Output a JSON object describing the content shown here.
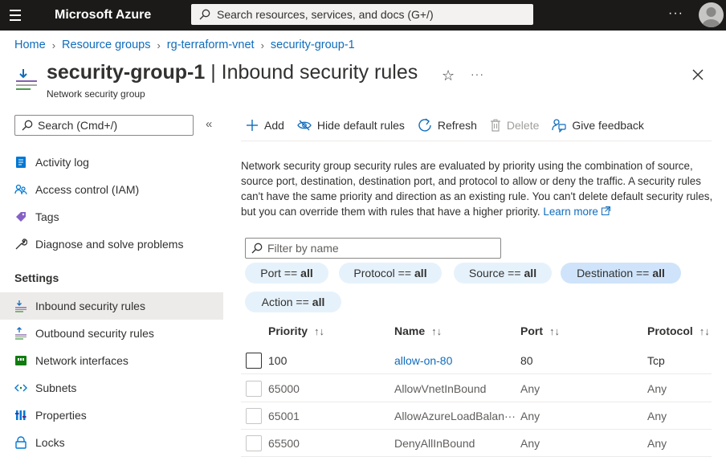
{
  "topbar": {
    "brand": "Microsoft Azure",
    "search_placeholder": "Search resources, services, and docs (G+/)",
    "more": "···"
  },
  "breadcrumb": [
    "Home",
    "Resource groups",
    "rg-terraform-vnet",
    "security-group-1"
  ],
  "header": {
    "title_bold": "security-group-1",
    "title_rest": " | Inbound security rules",
    "subtitle": "Network security group",
    "star": "☆",
    "more": "···"
  },
  "sidebar": {
    "search_placeholder": "Search (Cmd+/)",
    "collapse": "«",
    "items": [
      {
        "label": "Activity log"
      },
      {
        "label": "Access control (IAM)"
      },
      {
        "label": "Tags"
      },
      {
        "label": "Diagnose and solve problems"
      }
    ],
    "section": "Settings",
    "settings_items": [
      {
        "label": "Inbound security rules"
      },
      {
        "label": "Outbound security rules"
      },
      {
        "label": "Network interfaces"
      },
      {
        "label": "Subnets"
      },
      {
        "label": "Properties"
      },
      {
        "label": "Locks"
      }
    ]
  },
  "toolbar": {
    "add": "Add",
    "hide_default": "Hide default rules",
    "refresh": "Refresh",
    "delete": "Delete",
    "feedback": "Give feedback"
  },
  "description": {
    "text": "Network security group security rules are evaluated by priority using the combination of source, source port, destination, destination port, and protocol to allow or deny the traffic. A security rules can't have the same priority and direction as an existing rule. You can't delete default security rules, but you can override them with rules that have a higher priority.",
    "link": "Learn more"
  },
  "filters": {
    "placeholder": "Filter by name",
    "pills": [
      {
        "key": "Port ==",
        "value": "all"
      },
      {
        "key": "Protocol ==",
        "value": "all"
      },
      {
        "key": "Source ==",
        "value": "all"
      },
      {
        "key": "Destination ==",
        "value": "all"
      },
      {
        "key": "Action ==",
        "value": "all"
      }
    ]
  },
  "table": {
    "columns": [
      "Priority",
      "Name",
      "Port",
      "Protocol"
    ],
    "sort_glyph": "↑↓",
    "rows": [
      {
        "priority": "100",
        "name": "allow-on-80",
        "port": "80",
        "protocol": "Tcp"
      },
      {
        "priority": "65000",
        "name": "AllowVnetInBound",
        "port": "Any",
        "protocol": "Any"
      },
      {
        "priority": "65001",
        "name": "AllowAzureLoadBalan···",
        "port": "Any",
        "protocol": "Any"
      },
      {
        "priority": "65500",
        "name": "DenyAllInBound",
        "port": "Any",
        "protocol": "Any"
      }
    ]
  },
  "colors": {
    "topbar": "#1b1a19",
    "link": "#0f6cbd",
    "pill": "#e6f2fb",
    "pill_selected": "#cfe4fa"
  }
}
